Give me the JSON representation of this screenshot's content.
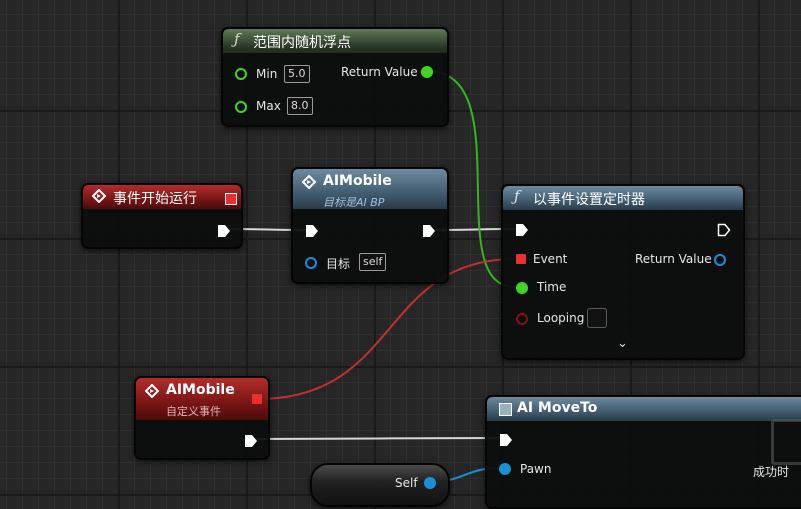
{
  "nodes": {
    "random_float": {
      "title": "范围内随机浮点",
      "pins": {
        "min_label": "Min",
        "min_value": "5.0",
        "max_label": "Max",
        "max_value": "8.0",
        "return_label": "Return Value"
      }
    },
    "event_begin_play": {
      "title": "事件开始运行"
    },
    "aimobile_cast": {
      "title": "AIMobile",
      "subtitle": "目标是AI BP",
      "pins": {
        "target_label": "目标",
        "target_value": "self"
      }
    },
    "set_timer_by_event": {
      "title": "以事件设置定时器",
      "pins": {
        "event_label": "Event",
        "time_label": "Time",
        "looping_label": "Looping",
        "return_label": "Return Value"
      }
    },
    "custom_event": {
      "title": "AIMobile",
      "subtitle": "自定义事件"
    },
    "ai_move_to": {
      "title": "AI MoveTo",
      "pins": {
        "pawn_label": "Pawn",
        "success_label": "成功时"
      }
    },
    "self_node": {
      "pin_label": "Self"
    }
  },
  "colors": {
    "exec": "#ffffff",
    "float_pin": "#3fd621",
    "object_pin": "#1a8fd6",
    "event_pin": "#e83030",
    "bool_pin": "#8a1010",
    "header_function": "#3c4f38",
    "header_event": "#9a1d1d",
    "header_call": "#4e6a80"
  },
  "icons": [
    "function-icon",
    "event-icon",
    "macro-icon",
    "chevron-down-icon"
  ]
}
